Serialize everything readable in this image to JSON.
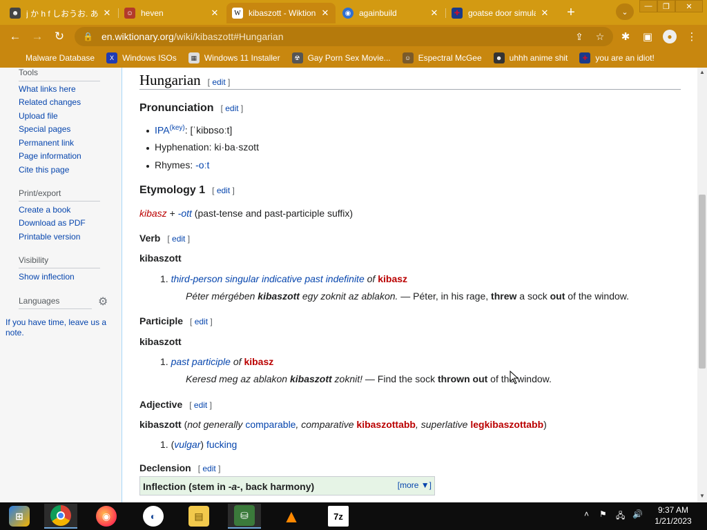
{
  "browser": {
    "tabs": [
      {
        "title": "j か h f しおうお. あ",
        "favicon": "anime-avatar-icon",
        "color": "#444444"
      },
      {
        "title": "heven",
        "favicon": "red-face-icon",
        "color": "#b33a2a"
      },
      {
        "title": "kibaszott - Wiktionary",
        "favicon": "wiktionary-icon",
        "color": "#ffffff"
      },
      {
        "title": "againbuild",
        "favicon": "blue-circle-icon",
        "color": "#2f6fd1"
      },
      {
        "title": "goatse door simulator",
        "favicon": "uk-flag-icon",
        "color": "#c8102e"
      }
    ],
    "active_tab": 2,
    "address": {
      "host": "en.wiktionary.org",
      "path": "/wiki/kibaszott#Hungarian"
    },
    "bookmarks": [
      {
        "label": "Malware Database",
        "icon": "malware-icon"
      },
      {
        "label": "Windows ISOs",
        "icon": "x-logo-icon"
      },
      {
        "label": "Windows 11 Installer",
        "icon": "installer-icon"
      },
      {
        "label": "Gay Porn Sex Movie...",
        "icon": "bookmark-icon"
      },
      {
        "label": "Espectral McGee",
        "icon": "character-icon"
      },
      {
        "label": "uhhh anime shit",
        "icon": "anime-icon"
      },
      {
        "label": "you are an idiot!",
        "icon": "uk-flag-icon"
      }
    ],
    "accent": "#c8870f"
  },
  "sidebar": {
    "tools_heading": "Tools",
    "tools": [
      "What links here",
      "Related changes",
      "Upload file",
      "Special pages",
      "Permanent link",
      "Page information",
      "Cite this page"
    ],
    "print_heading": "Print/export",
    "print": [
      "Create a book",
      "Download as PDF",
      "Printable version"
    ],
    "visibility_heading": "Visibility",
    "visibility": [
      "Show inflection"
    ],
    "languages_heading": "Languages",
    "note": "If you have time, leave us a note."
  },
  "article": {
    "lang_heading": "Hungarian",
    "edit": "edit",
    "pronunciation_heading": "Pronunciation",
    "ipa_label": "IPA",
    "ipa_key": "(key)",
    "ipa_value": ": [ˈkibɒsoːt]",
    "hyphenation": "Hyphenation: ki·ba·szott",
    "rhymes_label": "Rhymes: ",
    "rhymes_value": "-oːt",
    "etymology_heading": "Etymology 1",
    "etym_word": "kibasz",
    "etym_plus": " + ",
    "etym_suffix": "-ott",
    "etym_rest": " (past-tense and past-participle suffix)",
    "verb_heading": "Verb",
    "headword": "kibaszott",
    "verb_def_num": "1.",
    "verb_def_link": "third-person singular indicative past indefinite",
    "verb_def_of": " of ",
    "verb_def_target": "kibasz",
    "verb_ex_1": "Péter mérgében ",
    "verb_ex_2": "kibaszott",
    "verb_ex_3": " egy zoknit az ablakon.",
    "verb_ex_4": " — Péter, in his rage, ",
    "verb_ex_5": "threw",
    "verb_ex_6": " a sock ",
    "verb_ex_7": "out",
    "verb_ex_8": " of the window.",
    "participle_heading": "Participle",
    "part_def_num": "1.",
    "part_def_link": "past participle",
    "part_def_of": " of ",
    "part_def_target": "kibasz",
    "part_ex_1": "Keresd meg az ablakon ",
    "part_ex_2": "kibaszott",
    "part_ex_3": " zoknit!",
    "part_ex_4": " — Find the sock ",
    "part_ex_5": "thrown out",
    "part_ex_6": " of the window.",
    "adjective_heading": "Adjective",
    "adj_head_1": "kibaszott",
    "adj_head_2": " (",
    "adj_head_3": "not generally ",
    "adj_head_4": "comparable",
    "adj_head_5": ", comparative ",
    "adj_head_6": "kibaszottabb",
    "adj_head_7": ", superlative ",
    "adj_head_8": "legkibaszottabb",
    "adj_head_9": ")",
    "adj_def_num": "1.",
    "adj_def_open": "(",
    "adj_def_tag": "vulgar",
    "adj_def_close": ") ",
    "adj_def_word": "fucking",
    "declension_heading": "Declension",
    "inflection_1": "Inflection (stem in ",
    "inflection_2": "-a-",
    "inflection_3": ", back harmony)",
    "more": "[more ▼]"
  },
  "taskbar": {
    "time": "9:37 AM",
    "date": "1/21/2023",
    "apps": [
      "start-icon",
      "chrome-icon",
      "firefox-icon",
      "obama-logo-icon",
      "file-explorer-icon",
      "network-icon",
      "vlc-icon",
      "7zip-icon"
    ]
  }
}
